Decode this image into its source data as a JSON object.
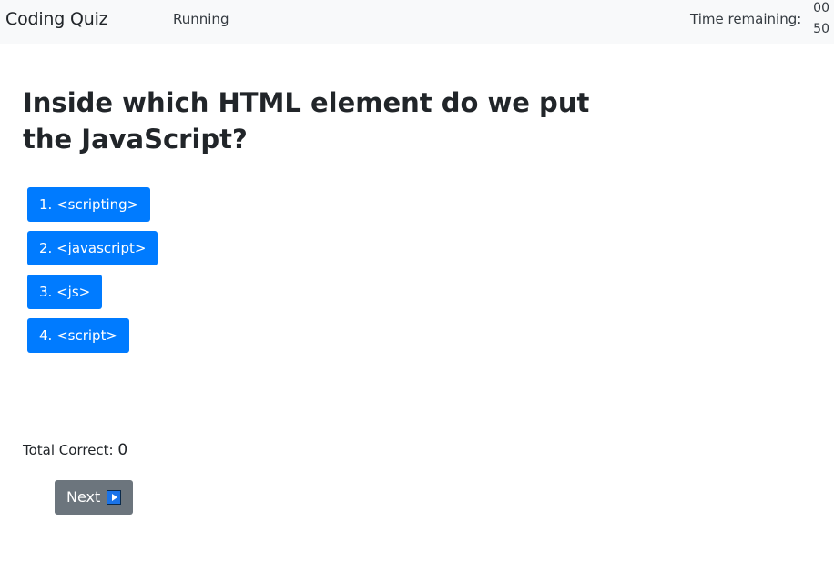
{
  "header": {
    "title": "Coding Quiz",
    "status": "Running",
    "time_label": "Time remaining:",
    "time_minutes": "00",
    "time_seconds": "50"
  },
  "quiz": {
    "question": "Inside which HTML element do we put the JavaScript?",
    "answers": [
      "1. <scripting>",
      "2. <javascript>",
      "3. <js>",
      "4. <script>"
    ]
  },
  "score": {
    "label": "Total Correct:",
    "value": "0"
  },
  "controls": {
    "next_label": "Next",
    "next_icon": "play-icon"
  },
  "colors": {
    "answer_button": "#007bff",
    "next_button": "#6c757d",
    "navbar": "#f8f9fa"
  }
}
